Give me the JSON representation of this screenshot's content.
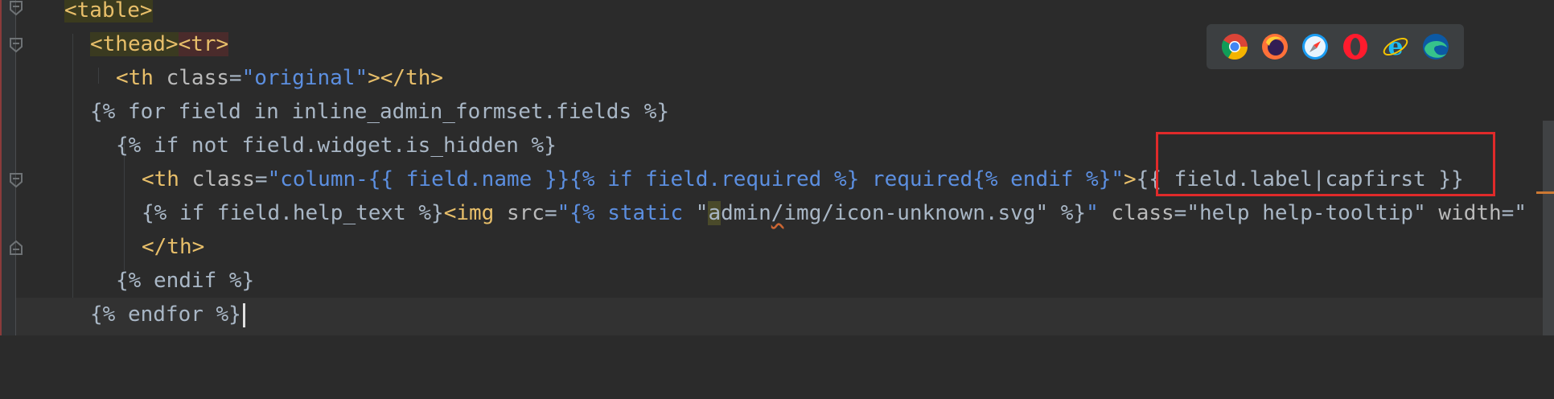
{
  "editor": {
    "lines": [
      {
        "id": "l1",
        "segments": [
          "<table>"
        ]
      },
      {
        "id": "l2",
        "segments": [
          "<thead>",
          "<tr>"
        ]
      },
      {
        "id": "l3",
        "segments": [
          "<th ",
          "class",
          "=",
          "\"original\"",
          "></th>"
        ]
      },
      {
        "id": "l4",
        "segments": [
          "{% for field in inline_admin_formset.fields %}"
        ]
      },
      {
        "id": "l5",
        "segments": [
          "{% if not field.widget.is_hidden %}"
        ]
      },
      {
        "id": "l6",
        "segments": [
          "<th ",
          "class",
          "=",
          "\"column-",
          "{{ field.name }}",
          "{% if field.required %}",
          " required",
          "{% endif %}",
          "\"",
          ">",
          "{{ field.label|capfirst }}"
        ]
      },
      {
        "id": "l7",
        "segments": [
          "{% if field.help_text %}",
          "<img ",
          "src",
          "=",
          "\"",
          "{% static ",
          "\"",
          "a",
          "dmin",
          "/",
          "img/icon-unknown.svg\" %}",
          "\"",
          " class",
          "=",
          "\"help help-tooltip\"",
          " width",
          "=",
          "\""
        ]
      },
      {
        "id": "l8",
        "segments": [
          "</th>"
        ]
      },
      {
        "id": "l9",
        "segments": [
          "{% endif %}"
        ]
      },
      {
        "id": "l10",
        "segments": [
          "{% endfor %}"
        ]
      }
    ]
  },
  "browser_bar": {
    "icons": [
      "chrome-icon",
      "firefox-icon",
      "safari-icon",
      "opera-icon",
      "internet-explorer-icon",
      "edge-icon"
    ]
  },
  "colors": {
    "background": "#2b2b2b",
    "tag": "#e8bf6a",
    "template": "#cc7832",
    "string": "#6a8759",
    "highlight_box": "#e02a2a"
  }
}
